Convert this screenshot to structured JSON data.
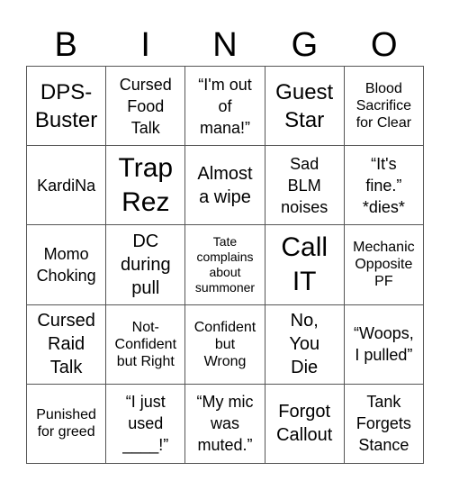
{
  "header": {
    "letters": [
      "B",
      "I",
      "N",
      "G",
      "O"
    ]
  },
  "cells": [
    [
      "DPS-\nBuster",
      "Cursed\nFood\nTalk",
      "“I'm out\nof\nmana!”",
      "Guest\nStar",
      "Blood\nSacrifice\nfor Clear"
    ],
    [
      "KardiNa",
      "Trap\nRez",
      "Almost\na wipe",
      "Sad\nBLM\nnoises",
      "“It's\nfine.”\n*dies*"
    ],
    [
      "Momo\nChoking",
      "DC\nduring\npull",
      "Tate\ncomplains\nabout\nsummoner",
      "Call\nIT",
      "Mechanic\nOpposite\nPF"
    ],
    [
      "Cursed\nRaid\nTalk",
      "Not-\nConfident\nbut Right",
      "Confident\nbut\nWrong",
      "No,\nYou\nDie",
      "“Woops,\nI pulled”"
    ],
    [
      "Punished\nfor greed",
      "“I just\nused\n____!”",
      "“My mic\nwas\nmuted.”",
      "Forgot\nCallout",
      "Tank\nForgets\nStance"
    ]
  ]
}
